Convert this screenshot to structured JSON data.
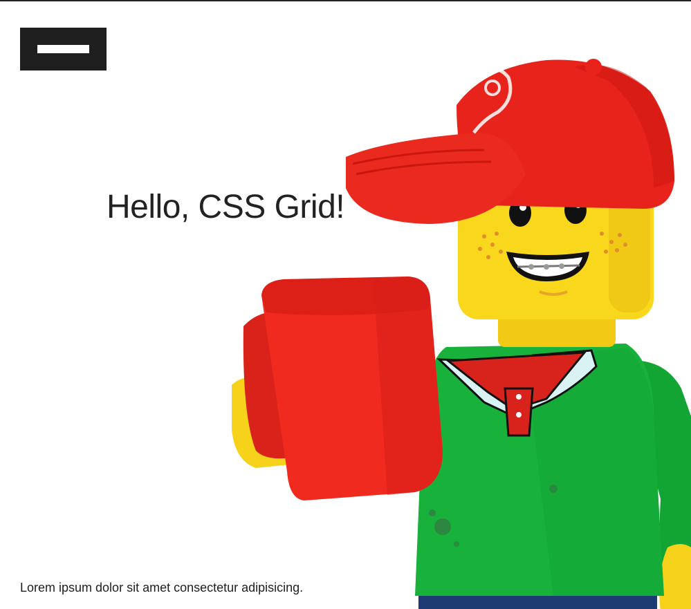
{
  "header": {
    "menu_label": "Menu"
  },
  "hero": {
    "title": "Hello, CSS Grid!",
    "image_alt": "LEGO minifigure in a red cap and green shirt holding a red mug"
  },
  "footer": {
    "text": "Lorem ipsum dolor sit amet consectetur adipisicing."
  },
  "colors": {
    "menu_background": "#1f1f1f",
    "text": "#222222",
    "cap_red": "#e8231b",
    "shirt_green": "#16b23a",
    "skin_yellow": "#f9d71c"
  }
}
